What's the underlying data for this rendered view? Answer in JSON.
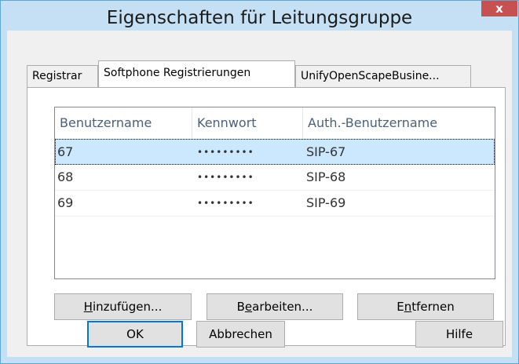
{
  "window": {
    "title": "Eigenschaften für Leitungsgruppe",
    "close_glyph": "x"
  },
  "tabs": [
    {
      "label": "Registrar",
      "active": false
    },
    {
      "label": "Softphone Registrierungen",
      "active": true
    },
    {
      "label": "UnifyOpenScapeBusine...",
      "active": false
    }
  ],
  "list": {
    "columns": [
      "Benutzername",
      "Kennwort",
      "Auth.-Benutzername"
    ],
    "rows": [
      {
        "user": "67",
        "password": "•••••••••",
        "auth": "SIP-67",
        "selected": true
      },
      {
        "user": "68",
        "password": "•••••••••",
        "auth": "SIP-68",
        "selected": false
      },
      {
        "user": "69",
        "password": "•••••••••",
        "auth": "SIP-69",
        "selected": false
      }
    ]
  },
  "panel_buttons": {
    "add": {
      "mnemonic": "H",
      "rest": "inzufügen..."
    },
    "edit": {
      "pre": "B",
      "mnemonic": "e",
      "rest": "arbeiten..."
    },
    "remove": {
      "pre": "E",
      "mnemonic": "n",
      "rest": "tfernen"
    }
  },
  "dialog_buttons": {
    "ok": "OK",
    "cancel": "Abbrechen",
    "help": "Hilfe"
  },
  "colors": {
    "title_bar": "#c5e0f4",
    "close_button": "#c75050",
    "selection": "#cce8ff",
    "default_button_border": "#0078d7"
  }
}
